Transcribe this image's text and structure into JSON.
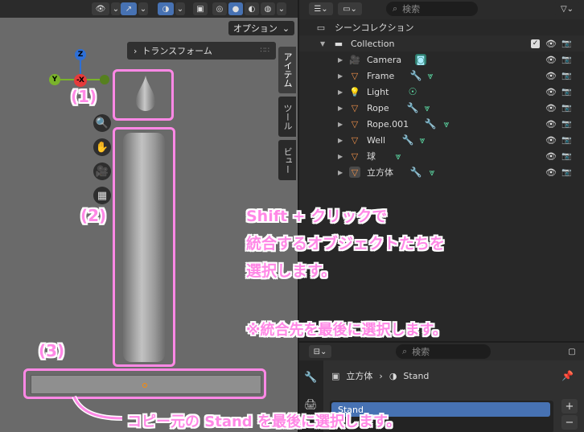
{
  "viewport": {
    "options_label": "オプション",
    "n_panel_title": "トランスフォーム",
    "side_tabs": [
      "アイテム",
      "ツール",
      "ビュー"
    ],
    "gizmo": {
      "z": "Z",
      "x": "-X",
      "y": "Y"
    }
  },
  "annotations": {
    "label1": "(1)",
    "label2": "(2)",
    "label3": "(3)",
    "instruction_line1": "Shift + クリックで",
    "instruction_line2": "統合するオブジェクトたちを",
    "instruction_line3": "選択します。",
    "note": "※統合先を最後に選択します。",
    "bottom": "コピー元の Stand を最後に選択します。"
  },
  "outliner": {
    "search_placeholder": "検索",
    "scene_collection": "シーンコレクション",
    "collection": "Collection",
    "items": [
      {
        "name": "Camera",
        "icon": "camera-icon"
      },
      {
        "name": "Frame",
        "icon": "mesh-icon"
      },
      {
        "name": "Light",
        "icon": "light-icon"
      },
      {
        "name": "Rope",
        "icon": "mesh-icon"
      },
      {
        "name": "Rope.001",
        "icon": "mesh-icon"
      },
      {
        "name": "Well",
        "icon": "mesh-icon"
      },
      {
        "name": "球",
        "icon": "mesh-icon"
      },
      {
        "name": "立方体",
        "icon": "mesh-icon"
      }
    ]
  },
  "properties": {
    "search_placeholder": "検索",
    "object_name": "立方体",
    "material_name": "Stand",
    "material_slot": "Stand"
  },
  "colors": {
    "highlight": "#ff88e6",
    "selection_blue": "#4772b3"
  }
}
